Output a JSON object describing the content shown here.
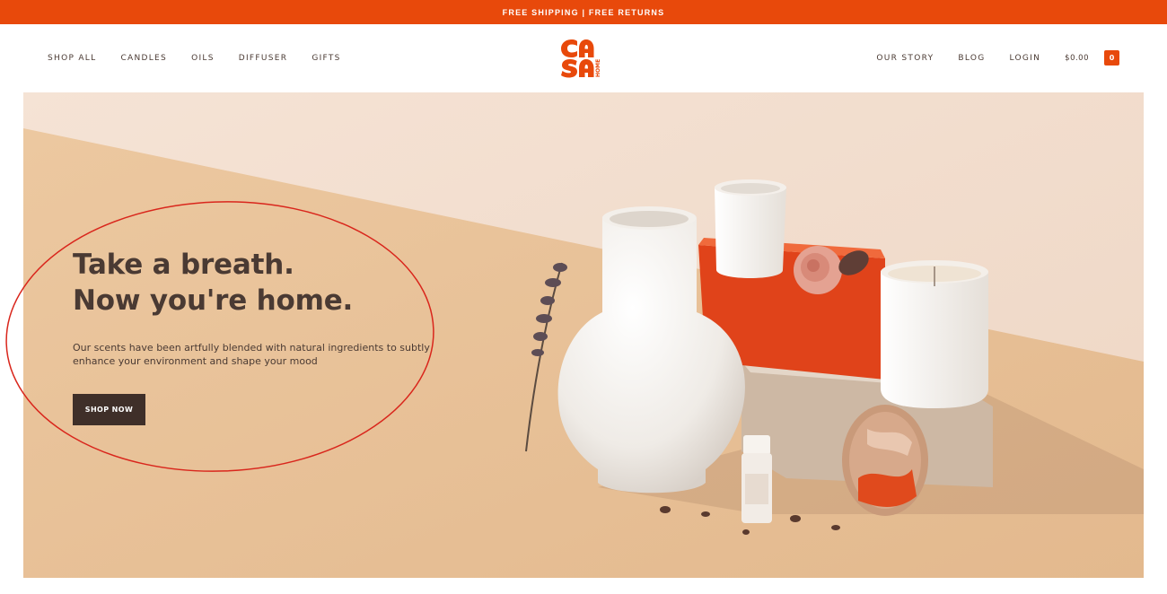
{
  "announcement": {
    "text": "FREE SHIPPING | FREE RETURNS"
  },
  "nav_left": [
    {
      "label": "SHOP ALL"
    },
    {
      "label": "CANDLES"
    },
    {
      "label": "OILS"
    },
    {
      "label": "DIFFUSER"
    },
    {
      "label": "GIFTS"
    }
  ],
  "nav_right": [
    {
      "label": "OUR STORY"
    },
    {
      "label": "BLOG"
    },
    {
      "label": "LOGIN"
    }
  ],
  "cart": {
    "total": "$0.00",
    "count": "0"
  },
  "logo": {
    "letters_top": "CA",
    "letters_bottom": "SA",
    "side_text": "HOME"
  },
  "hero": {
    "headline_line1": "Take a breath.",
    "headline_line2": "Now you're home.",
    "body": "Our scents have been artfully blended with natural ingredients to subtly enhance your environment and shape your mood",
    "cta": "SHOP NOW"
  },
  "colors": {
    "accent": "#e8490b",
    "text_dark": "#4a3a33",
    "button_bg": "#3f2f29",
    "annotation": "#d9261c"
  }
}
